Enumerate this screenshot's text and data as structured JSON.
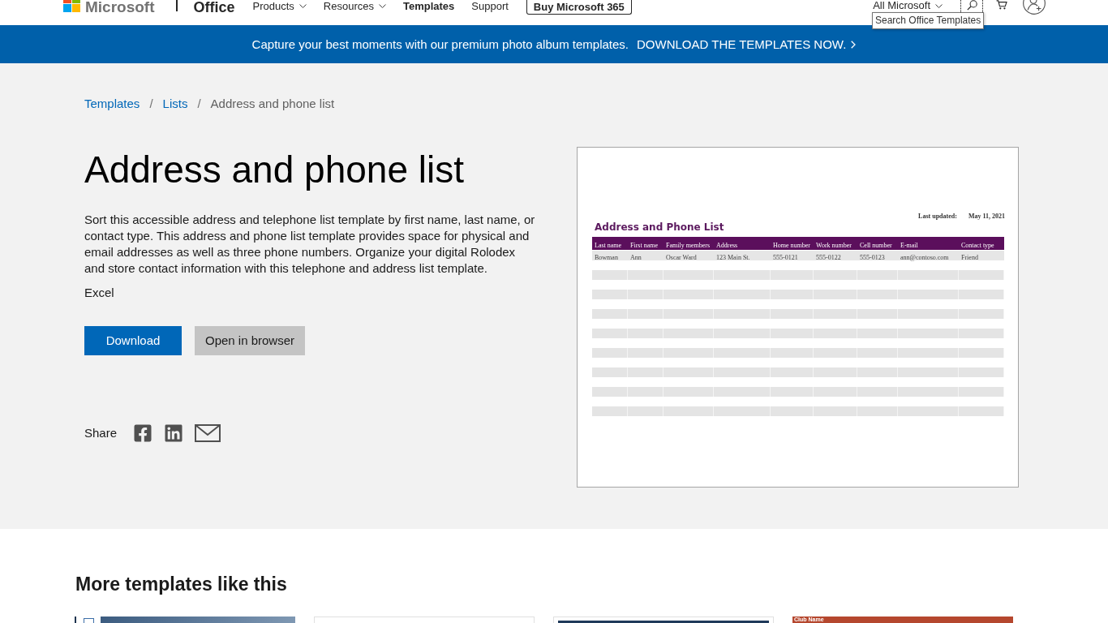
{
  "header": {
    "brand": "Microsoft",
    "product": "Office",
    "nav": [
      {
        "label": "Products",
        "dropdown": true,
        "selected": false
      },
      {
        "label": "Resources",
        "dropdown": true,
        "selected": false
      },
      {
        "label": "Templates",
        "dropdown": false,
        "selected": true
      },
      {
        "label": "Support",
        "dropdown": false,
        "selected": false
      }
    ],
    "cta": "Buy Microsoft 365",
    "all_microsoft": {
      "label": "All Microsoft",
      "dropdown": true
    },
    "search_tooltip": "Search Office Templates"
  },
  "banner": {
    "text": "Capture your best moments with our premium photo album templates.",
    "link": "DOWNLOAD THE TEMPLATES NOW."
  },
  "breadcrumb": [
    {
      "label": "Templates",
      "link": true
    },
    {
      "label": "Lists",
      "link": true,
      "separator": "/"
    },
    {
      "label": "Address and phone list",
      "link": false,
      "separator": "/"
    }
  ],
  "title": "Address and phone list",
  "description": "Sort this accessible address and telephone list template by first name, last name, or contact type. This address and phone list template provides space for physical and email addresses as well as three phone numbers. Organize your digital Rolodex and store contact information with this telephone and address list template.",
  "app": "Excel",
  "buttons": [
    {
      "label": "Download",
      "kind": "primary"
    },
    {
      "label": "Open in browser",
      "kind": "secondary"
    }
  ],
  "share": {
    "label": "Share"
  },
  "preview": {
    "last_updated_label": "Last updated:",
    "last_updated": "May 11, 2021",
    "title": "Address and Phone List",
    "columns": [
      "Last name",
      "First name",
      "Family members",
      "Address",
      "Home number",
      "Work number",
      "Cell number",
      "E-mail",
      "Contact type"
    ],
    "rows": [
      [
        "Bowman",
        "Ann",
        "Oscar Ward",
        "123 Main St.",
        "555-0121",
        "555-0122",
        "555-0123",
        "ann@contoso.com",
        "Friend"
      ]
    ]
  },
  "more": {
    "heading": "More templates like this",
    "thumbnails": [
      {
        "kind": "photo"
      },
      {
        "kind": "blank"
      },
      {
        "kind": "banner"
      },
      {
        "kind": "titled",
        "title": "Club Name"
      }
    ]
  }
}
